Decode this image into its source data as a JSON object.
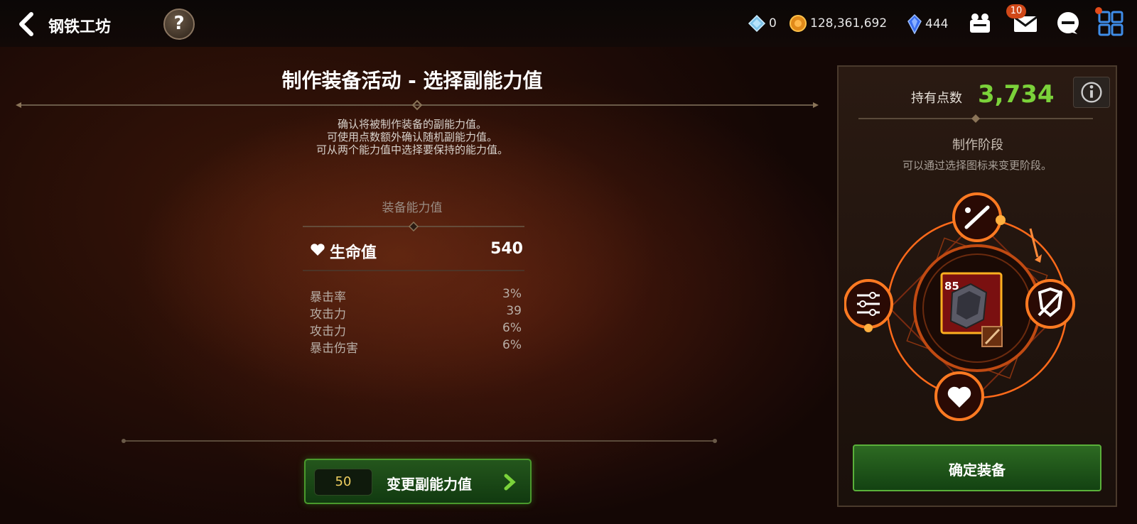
{
  "header": {
    "title": "钢铁工坊",
    "help_label": "?",
    "diamond": "0",
    "gold": "128,361,692",
    "crystal": "444",
    "mail_badge": "10"
  },
  "main": {
    "title": "制作装备活动 - 选择副能力值",
    "desc_lines": [
      "确认将被制作装备的副能力值。",
      "可使用点数额外确认随机副能力值。",
      "可从两个能力值中选择要保持的能力值。"
    ],
    "stat_heading": "装备能力值",
    "main_stat": {
      "name": "生命值",
      "value": "540"
    },
    "sub_stats": [
      {
        "name": "暴击率",
        "value": "3%"
      },
      {
        "name": "攻击力",
        "value": "39"
      },
      {
        "name": "攻击力",
        "value": "6%"
      },
      {
        "name": "暴击伤害",
        "value": "6%"
      }
    ],
    "change_cost": "50",
    "change_label": "变更副能力值"
  },
  "panel": {
    "points_label": "持有点数",
    "points_value": "3,734",
    "stage_label": "制作阶段",
    "stage_desc": "可以通过选择图标来变更阶段。",
    "item_level": "85",
    "confirm_label": "确定装备"
  },
  "icons": [
    "back-arrow-icon",
    "help-icon",
    "diamond-icon",
    "gold-coin-icon",
    "crystal-icon",
    "guild-icon",
    "mail-icon",
    "chat-icon",
    "menu-grid-icon",
    "heart-icon",
    "chevron-right-icon",
    "info-icon",
    "sword-icon",
    "shield-break-icon",
    "sliders-icon"
  ],
  "colors": {
    "points": "#7bd23a",
    "button_green": "#2d6a22",
    "ring_orange": "#ff6a1a"
  }
}
